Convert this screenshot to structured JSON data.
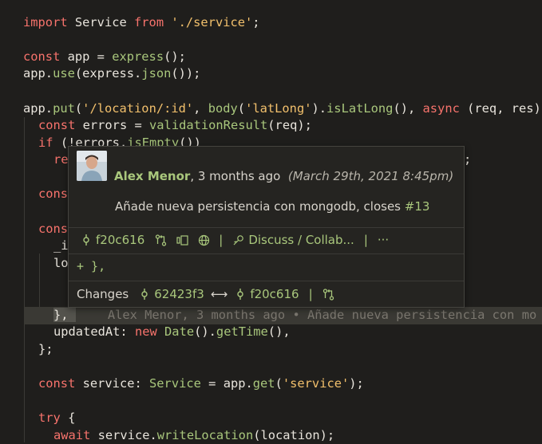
{
  "code": {
    "line1": {
      "kw": "import",
      "name": " Service ",
      "kw2": "from",
      "str": " './service'",
      "end": ";"
    },
    "line3": {
      "kw": "const",
      "rest": " app = ",
      "fn": "express",
      "end": "();"
    },
    "line4": {
      "a": "app.",
      "fn": "use",
      "b": "(express.",
      "fn2": "json",
      "c": "());"
    },
    "line6": {
      "a": "app.",
      "fn": "put",
      "b": "(",
      "str": "'/location/:id'",
      "c": ", ",
      "fn2": "body",
      "d": "(",
      "str2": "'latLong'",
      "e": ").",
      "fn3": "isLatLong",
      "f": "(), ",
      "kw": "async",
      "g": " (req, res)"
    },
    "line7": {
      "kw": "const",
      "rest": " errors = ",
      "fn": "validationResult",
      "end": "(req);"
    },
    "line8": {
      "kw": "if",
      "rest": " (!errors.",
      "fn": "isEmpty",
      "end": "())"
    },
    "line9_frag": "re",
    "line9_tail": ";",
    "line11_frag": "cons",
    "line13_frag": "cons",
    "line14_frag": "_i",
    "line15_frag": "lo",
    "line18": {
      "a": "}, ",
      "blame": "Alex Menor, 3 months ago • Añade nueva persistencia con mo"
    },
    "line19": {
      "a": "updatedAt: ",
      "kw": "new",
      "b": " ",
      "fn": "Date",
      "c": "().",
      "fn2": "getTime",
      "d": "(),"
    },
    "line20": "};",
    "line22": {
      "kw": "const",
      "a": " service: ",
      "ty": "Service",
      "b": " = app.",
      "fn": "get",
      "c": "(",
      "str": "'service'",
      "d": ");"
    },
    "line24": {
      "kw": "try",
      "a": " {"
    },
    "line25": {
      "kw": "await",
      "a": " service.",
      "fn": "writeLocation",
      "b": "(location);"
    }
  },
  "hover": {
    "author": "Alex Menor",
    "when": ", 3 months ago",
    "date": "(March 29th, 2021 8:45pm)",
    "message": "Añade nueva persistencia con mongodb, closes ",
    "issue": "#13",
    "sha": "f20c616",
    "discuss": "Discuss / Collab...",
    "more": "···",
    "diff": "+ },",
    "changes_label": "Changes",
    "from_sha": "62423f3",
    "arrow": "⟷",
    "to_sha": "f20c616",
    "pipe": "|"
  },
  "colors": {
    "keyword": "#f7736c",
    "function": "#a9c77c",
    "string": "#f2c06c",
    "background": "#1f1e1c"
  }
}
